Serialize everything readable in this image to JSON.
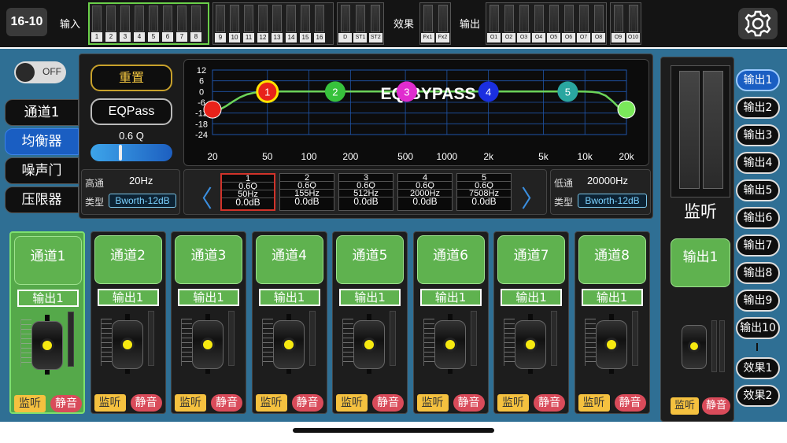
{
  "topbar": {
    "model": "16-10",
    "input_label": "输入",
    "effect_label": "效果",
    "output_label": "输出",
    "inputs_a": [
      "1",
      "2",
      "3",
      "4",
      "5",
      "6",
      "7",
      "8"
    ],
    "inputs_b": [
      "9",
      "10",
      "11",
      "12",
      "13",
      "14",
      "15",
      "16"
    ],
    "inputs_c": [
      "D",
      "ST1",
      "ST2"
    ],
    "effects": [
      "Fx1",
      "Fx2"
    ],
    "outputs_a": [
      "O1",
      "O2",
      "O3",
      "O4",
      "O5",
      "O6",
      "O7",
      "O8"
    ],
    "outputs_b": [
      "O9",
      "O10"
    ],
    "settings_icon": "gear-icon"
  },
  "power_toggle": {
    "label": "OFF",
    "state": "off"
  },
  "side_tabs": [
    {
      "label": "通道1",
      "active": false
    },
    {
      "label": "均衡器",
      "active": true
    },
    {
      "label": "噪声门",
      "active": false
    },
    {
      "label": "压限器",
      "active": false
    }
  ],
  "eq": {
    "reset_label": "重置",
    "eqpass_label": "EQPass",
    "q_label": "0.6 Q",
    "q_value": 0.6,
    "bypass_text": "EQ BYPASS",
    "y_ticks": [
      "12",
      "6",
      "0",
      "-6",
      "-12",
      "-18",
      "-24"
    ],
    "x_ticks": [
      "20",
      "50",
      "100",
      "200",
      "500",
      "1000",
      "2k",
      "5k",
      "10k",
      "20k"
    ],
    "highpass": {
      "label": "高通",
      "freq": "20Hz",
      "type_label": "类型",
      "type": "Bworth-12dB"
    },
    "lowpass": {
      "label": "低通",
      "freq": "20000Hz",
      "type_label": "类型",
      "type": "Bworth-12dB"
    },
    "prev_icon": "chevron-left-icon",
    "next_icon": "chevron-right-icon",
    "bands": [
      {
        "num": "1",
        "q": "0.6Q",
        "freq": "50Hz",
        "gain": "0.0dB",
        "selected": true,
        "color": "#e8221a"
      },
      {
        "num": "2",
        "q": "0.6Q",
        "freq": "155Hz",
        "gain": "0.0dB",
        "selected": false,
        "color": "#37c23c"
      },
      {
        "num": "3",
        "q": "0.6Q",
        "freq": "512Hz",
        "gain": "0.0dB",
        "selected": false,
        "color": "#e02ccf"
      },
      {
        "num": "4",
        "q": "0.6Q",
        "freq": "2000Hz",
        "gain": "0.0dB",
        "selected": false,
        "color": "#1a2fe0"
      },
      {
        "num": "5",
        "q": "0.6Q",
        "freq": "7508Hz",
        "gain": "0.0dB",
        "selected": false,
        "color": "#2aa6a0"
      }
    ]
  },
  "channels": [
    {
      "name": "通道1",
      "route": "输出1",
      "monitor": "监听",
      "mute": "静音",
      "selected": true
    },
    {
      "name": "通道2",
      "route": "输出1",
      "monitor": "监听",
      "mute": "静音",
      "selected": false
    },
    {
      "name": "通道3",
      "route": "输出1",
      "monitor": "监听",
      "mute": "静音",
      "selected": false
    },
    {
      "name": "通道4",
      "route": "输出1",
      "monitor": "监听",
      "mute": "静音",
      "selected": false
    },
    {
      "name": "通道5",
      "route": "输出1",
      "monitor": "监听",
      "mute": "静音",
      "selected": false
    },
    {
      "name": "通道6",
      "route": "输出1",
      "monitor": "监听",
      "mute": "静音",
      "selected": false
    },
    {
      "name": "通道7",
      "route": "输出1",
      "monitor": "监听",
      "mute": "静音",
      "selected": false
    },
    {
      "name": "通道8",
      "route": "输出1",
      "monitor": "监听",
      "mute": "静音",
      "selected": false
    }
  ],
  "monitor": {
    "label": "监听",
    "output_name": "输出1",
    "monitor": "监听",
    "mute": "静音"
  },
  "outputs": [
    {
      "label": "输出1",
      "active": true
    },
    {
      "label": "输出2",
      "active": false
    },
    {
      "label": "输出3",
      "active": false
    },
    {
      "label": "输出4",
      "active": false
    },
    {
      "label": "输出5",
      "active": false
    },
    {
      "label": "输出6",
      "active": false
    },
    {
      "label": "输出7",
      "active": false
    },
    {
      "label": "输出8",
      "active": false
    },
    {
      "label": "输出9",
      "active": false
    },
    {
      "label": "输出10",
      "active": false
    }
  ],
  "effect_outputs": [
    {
      "label": "效果1",
      "active": false
    },
    {
      "label": "效果2",
      "active": false
    }
  ]
}
